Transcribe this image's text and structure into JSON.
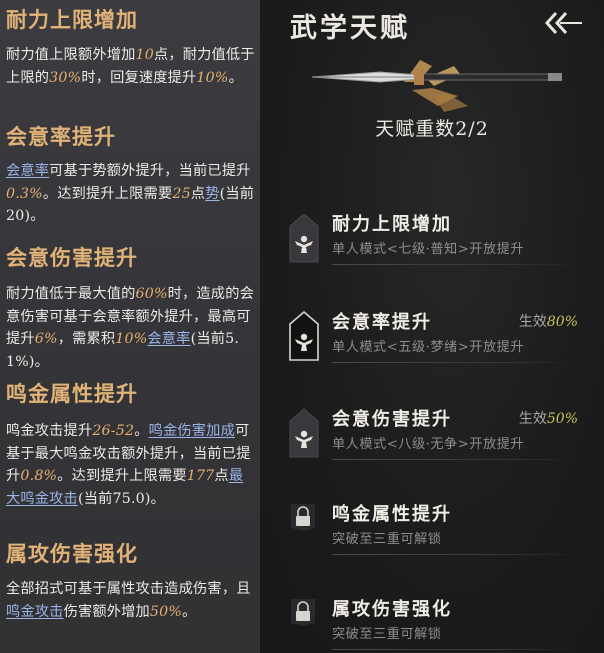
{
  "left_panel": {
    "sections": [
      {
        "title": "耐力上限增加",
        "runs": [
          {
            "t": "耐力值上限额外增加",
            "s": ""
          },
          {
            "t": "10",
            "s": "hl"
          },
          {
            "t": "点，耐力值低于上限的",
            "s": ""
          },
          {
            "t": "30%",
            "s": "hl"
          },
          {
            "t": "时，回复速度提升",
            "s": ""
          },
          {
            "t": "10%",
            "s": "hl"
          },
          {
            "t": "。",
            "s": ""
          }
        ]
      },
      {
        "title": "会意率提升",
        "runs": [
          {
            "t": "会意率",
            "s": "lk"
          },
          {
            "t": "可基于势额外提升，当前已提升",
            "s": ""
          },
          {
            "t": "0.3%",
            "s": "hl"
          },
          {
            "t": "。达到提升上限需要",
            "s": ""
          },
          {
            "t": "25",
            "s": "hl"
          },
          {
            "t": "点",
            "s": ""
          },
          {
            "t": "势",
            "s": "lk"
          },
          {
            "t": "(当前20)。",
            "s": ""
          }
        ]
      },
      {
        "title": "会意伤害提升",
        "runs": [
          {
            "t": "耐力值低于最大值的",
            "s": ""
          },
          {
            "t": "60%",
            "s": "hl"
          },
          {
            "t": "时，造成的会意伤害可基于会意率额外提升，最高可提升",
            "s": ""
          },
          {
            "t": "6%",
            "s": "hl"
          },
          {
            "t": "，需累积",
            "s": ""
          },
          {
            "t": "10%",
            "s": "hl"
          },
          {
            "t": "会意率",
            "s": "lk"
          },
          {
            "t": "(当前5.1%)。",
            "s": ""
          }
        ]
      },
      {
        "title": "鸣金属性提升",
        "runs": [
          {
            "t": "鸣金攻击提升",
            "s": ""
          },
          {
            "t": "26-52",
            "s": "hl"
          },
          {
            "t": "。",
            "s": ""
          },
          {
            "t": "鸣金伤害加成",
            "s": "lk"
          },
          {
            "t": "可基于最大鸣金攻击额外提升，当前已提升",
            "s": ""
          },
          {
            "t": "0.8%",
            "s": "hl"
          },
          {
            "t": "。达到提升上限需要",
            "s": ""
          },
          {
            "t": "177",
            "s": "hl"
          },
          {
            "t": "点",
            "s": ""
          },
          {
            "t": "最大鸣金攻击",
            "s": "lk"
          },
          {
            "t": "(当前75.0)。",
            "s": ""
          }
        ]
      },
      {
        "title": "属攻伤害强化",
        "runs": [
          {
            "t": "全部招式可基于属性攻击造成伤害，且",
            "s": ""
          },
          {
            "t": "鸣金攻击",
            "s": "lk"
          },
          {
            "t": "伤害额外增加",
            "s": ""
          },
          {
            "t": "50%",
            "s": "hl"
          },
          {
            "t": "。",
            "s": ""
          }
        ]
      }
    ]
  },
  "right_panel": {
    "title": "武学天赋",
    "back_icon": "double-chevron-left-icon",
    "tier_label": "天赋重数2/2",
    "talents": [
      {
        "name": "耐力上限增加",
        "sub": "单人模式<七级·普知>开放提升",
        "status_label": "",
        "status_value": "",
        "badge": "large"
      },
      {
        "name": "会意率提升",
        "sub": "单人模式<五级·梦绪>开放提升",
        "status_label": "生效",
        "status_value": "80%",
        "badge": "large-outline"
      },
      {
        "name": "会意伤害提升",
        "sub": "单人模式<八级·无争>开放提升",
        "status_label": "生效",
        "status_value": "50%",
        "badge": "large"
      },
      {
        "name": "鸣金属性提升",
        "sub": "突破至三重可解锁",
        "status_label": "",
        "status_value": "",
        "badge": "small"
      },
      {
        "name": "属攻伤害强化",
        "sub": "突破至三重可解锁",
        "status_label": "",
        "status_value": "",
        "badge": "small"
      }
    ]
  },
  "colors": {
    "accent_gold": "#e1b277",
    "link_blue": "#9ab4e8",
    "effect_yellow": "#c6c05c"
  }
}
